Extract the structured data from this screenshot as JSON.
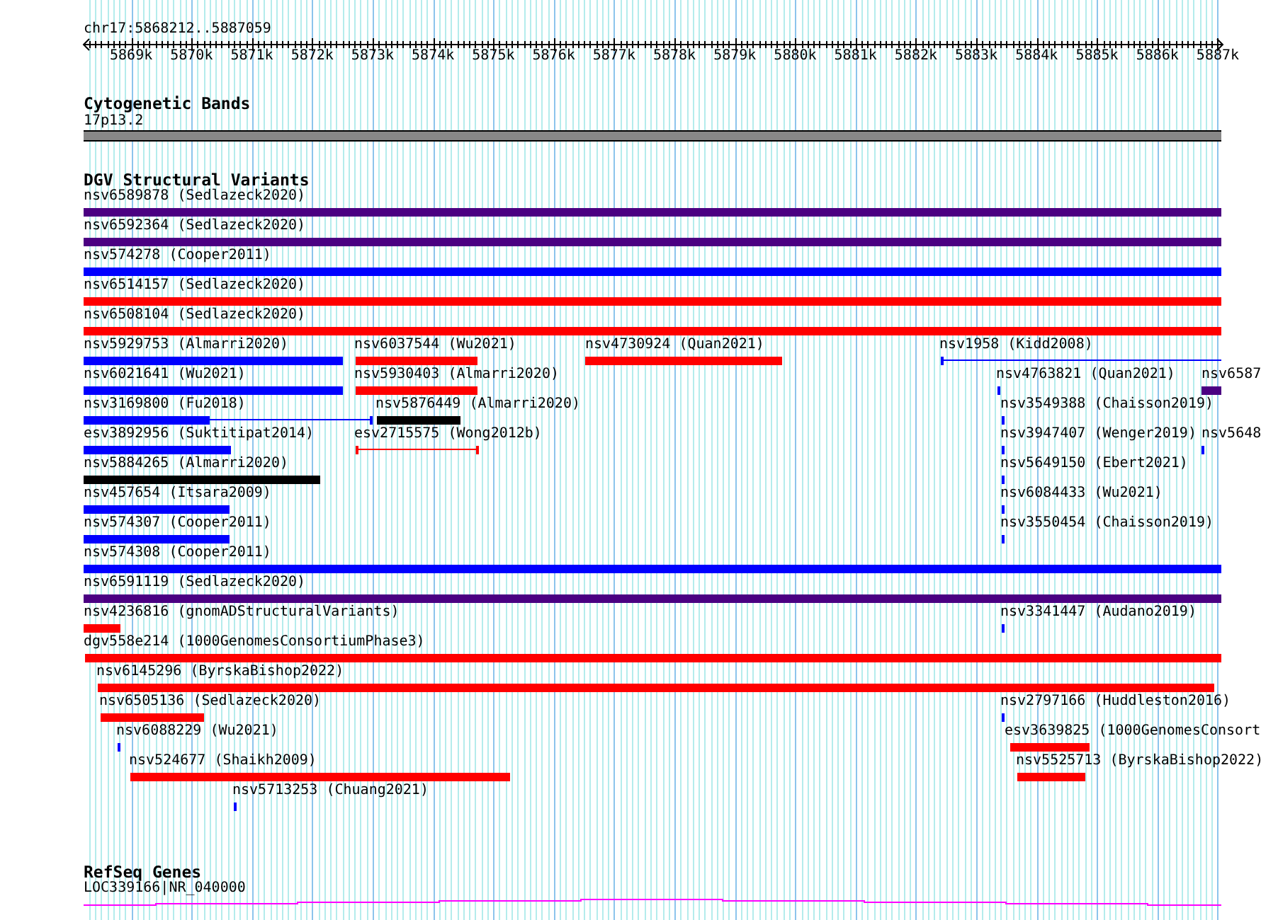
{
  "ruler": {
    "region": "chr17:5868212..5887059",
    "tick_labels": [
      "5869k",
      "5870k",
      "5871k",
      "5872k",
      "5873k",
      "5874k",
      "5875k",
      "5876k",
      "5877k",
      "5878k",
      "5879k",
      "5880k",
      "5881k",
      "5882k",
      "5883k",
      "5884k",
      "5885k",
      "5886k",
      "5887k"
    ]
  },
  "cytoband_track": {
    "title": "Cytogenetic Bands",
    "band": "17p13.2"
  },
  "dgv_track": {
    "title": "DGV Structural Variants",
    "rows": [
      {
        "features": [
          {
            "label": "nsv6589878 (Sedlazeck2020)",
            "color": "#4b0082",
            "kind": "bar"
          }
        ]
      },
      {
        "features": [
          {
            "label": "nsv6592364 (Sedlazeck2020)",
            "color": "#4b0082",
            "kind": "bar"
          }
        ]
      },
      {
        "features": [
          {
            "label": "nsv574278 (Cooper2011)",
            "color": "#0000ff",
            "kind": "bar"
          }
        ]
      },
      {
        "features": [
          {
            "label": "nsv6514157 (Sedlazeck2020)",
            "color": "#ff0000",
            "kind": "bar"
          }
        ]
      },
      {
        "features": [
          {
            "label": "nsv6508104 (Sedlazeck2020)",
            "color": "#ff0000",
            "kind": "bar"
          }
        ]
      },
      {
        "features": [
          {
            "label": "nsv5929753 (Almarri2020)",
            "color": "#0000ff",
            "kind": "bar"
          },
          {
            "label": "nsv6037544 (Wu2021)",
            "color": "#ff0000",
            "kind": "bar"
          },
          {
            "label": "nsv4730924 (Quan2021)",
            "color": "#ff0000",
            "kind": "bar"
          },
          {
            "label": "nsv1958 (Kidd2008)",
            "color": "#0000ff",
            "kind": "line"
          }
        ]
      },
      {
        "features": [
          {
            "label": "nsv6021641 (Wu2021)",
            "color": "#0000ff",
            "kind": "bar"
          },
          {
            "label": "nsv5930403 (Almarri2020)",
            "color": "#ff0000",
            "kind": "bar"
          },
          {
            "label": "nsv4763821 (Quan2021)",
            "color": "#0000ff",
            "kind": "bar"
          },
          {
            "label": "nsv6587",
            "color": "#4b0082",
            "kind": "bar"
          }
        ]
      },
      {
        "features": [
          {
            "label": "nsv3169800 (Fu2018)",
            "color": "#0000ff",
            "kind": "bar-line"
          },
          {
            "label": "nsv5876449 (Almarri2020)",
            "color": "#000000",
            "kind": "bar"
          },
          {
            "label": "nsv3549388 (Chaisson2019)",
            "color": "#0000ff",
            "kind": "bar"
          }
        ]
      },
      {
        "features": [
          {
            "label": "esv3892956 (Suktitipat2014)",
            "color": "#0000ff",
            "kind": "bar"
          },
          {
            "label": "esv2715575 (Wong2012b)",
            "color": "#ff0000",
            "kind": "line"
          },
          {
            "label": "nsv3947407 (Wenger2019)",
            "color": "#0000ff",
            "kind": "bar"
          },
          {
            "label": "nsv5648",
            "color": "#0000ff",
            "kind": "bar"
          }
        ]
      },
      {
        "features": [
          {
            "label": "nsv5884265 (Almarri2020)",
            "color": "#000000",
            "kind": "bar"
          },
          {
            "label": "nsv5649150 (Ebert2021)",
            "color": "#0000ff",
            "kind": "bar"
          }
        ]
      },
      {
        "features": [
          {
            "label": "nsv457654 (Itsara2009)",
            "color": "#0000ff",
            "kind": "bar"
          },
          {
            "label": "nsv6084433 (Wu2021)",
            "color": "#0000ff",
            "kind": "bar"
          }
        ]
      },
      {
        "features": [
          {
            "label": "nsv574307 (Cooper2011)",
            "color": "#0000ff",
            "kind": "bar"
          },
          {
            "label": "nsv3550454 (Chaisson2019)",
            "color": "#0000ff",
            "kind": "bar"
          }
        ]
      },
      {
        "features": [
          {
            "label": "nsv574308 (Cooper2011)",
            "color": "#0000ff",
            "kind": "bar"
          }
        ]
      },
      {
        "features": [
          {
            "label": "nsv6591119 (Sedlazeck2020)",
            "color": "#4b0082",
            "kind": "bar"
          }
        ]
      },
      {
        "features": [
          {
            "label": "nsv4236816 (gnomADStructuralVariants)",
            "color": "#ff0000",
            "kind": "bar"
          },
          {
            "label": "nsv3341447 (Audano2019)",
            "color": "#0000ff",
            "kind": "bar"
          }
        ]
      },
      {
        "features": [
          {
            "label": "dgv558e214 (1000GenomesConsortiumPhase3)",
            "color": "#ff0000",
            "kind": "bar"
          }
        ]
      },
      {
        "features": [
          {
            "label": "nsv6145296 (ByrskaBishop2022)",
            "color": "#ff0000",
            "kind": "bar"
          }
        ]
      },
      {
        "features": [
          {
            "label": "nsv6505136 (Sedlazeck2020)",
            "color": "#ff0000",
            "kind": "bar"
          },
          {
            "label": "nsv2797166 (Huddleston2016)",
            "color": "#0000ff",
            "kind": "bar"
          }
        ]
      },
      {
        "features": [
          {
            "label": "nsv6088229 (Wu2021)",
            "color": "#0000ff",
            "kind": "bar"
          },
          {
            "label": "esv3639825 (1000GenomesConsort",
            "color": "#ff0000",
            "kind": "bar"
          }
        ]
      },
      {
        "features": [
          {
            "label": "nsv524677 (Shaikh2009)",
            "color": "#ff0000",
            "kind": "bar"
          },
          {
            "label": "nsv5525713 (ByrskaBishop2022)",
            "color": "#ff0000",
            "kind": "bar"
          }
        ]
      },
      {
        "features": [
          {
            "label": "nsv5713253 (Chuang2021)",
            "color": "#0000ff",
            "kind": "bar"
          }
        ]
      }
    ]
  },
  "refseq_track": {
    "title": "RefSeq Genes",
    "gene": "LOC339166|NR_040000"
  }
}
